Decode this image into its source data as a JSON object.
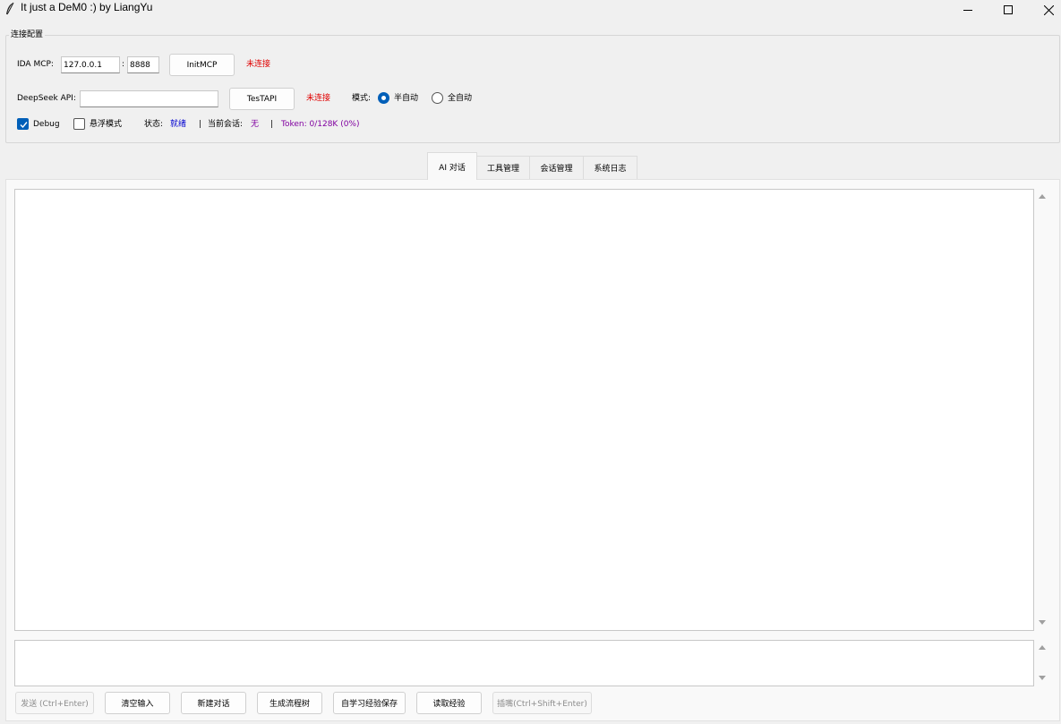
{
  "window": {
    "title": "It just a DeM0 :) by LiangYu"
  },
  "config": {
    "group_title": "连接配置",
    "ida_label": "IDA MCP:",
    "ida_host": "127.0.0.1",
    "ida_sep": ":",
    "ida_port": "8888",
    "init_button": "InitMCP",
    "ida_status": "未连接",
    "deepseek_label": "DeepSeek API:",
    "deepseek_key": "",
    "test_button": "TesTAPI",
    "api_status": "未连接",
    "mode_label": "模式:",
    "mode_options": [
      "半自动",
      "全自动"
    ],
    "mode_selected": "半自动",
    "debug_label": "Debug",
    "debug_checked": true,
    "float_label": "悬浮模式",
    "float_checked": false,
    "state_label": "状态:",
    "state_value": "就绪",
    "sep1": "|",
    "session_label": "当前会话:",
    "session_value": "无",
    "sep2": "|",
    "token_text": "Token: 0/128K (0%)"
  },
  "tabs": [
    {
      "label": "AI 对话",
      "active": true
    },
    {
      "label": "工具管理",
      "active": false
    },
    {
      "label": "会话管理",
      "active": false
    },
    {
      "label": "系统日志",
      "active": false
    }
  ],
  "chat": {
    "output_text": "",
    "input_text": ""
  },
  "actions": {
    "send": "发送 (Ctrl+Enter)",
    "clear": "清空输入",
    "new_chat": "新建对话",
    "flow_tree": "生成流程树",
    "save_exp": "自学习经验保存",
    "read_exp": "读取经验",
    "interrupt": "插嘴(Ctrl+Shift+Enter)"
  },
  "colors": {
    "status_error": "#e00000",
    "status_ready": "#0000d0",
    "token": "#8000a0",
    "accent": "#005fb8"
  }
}
